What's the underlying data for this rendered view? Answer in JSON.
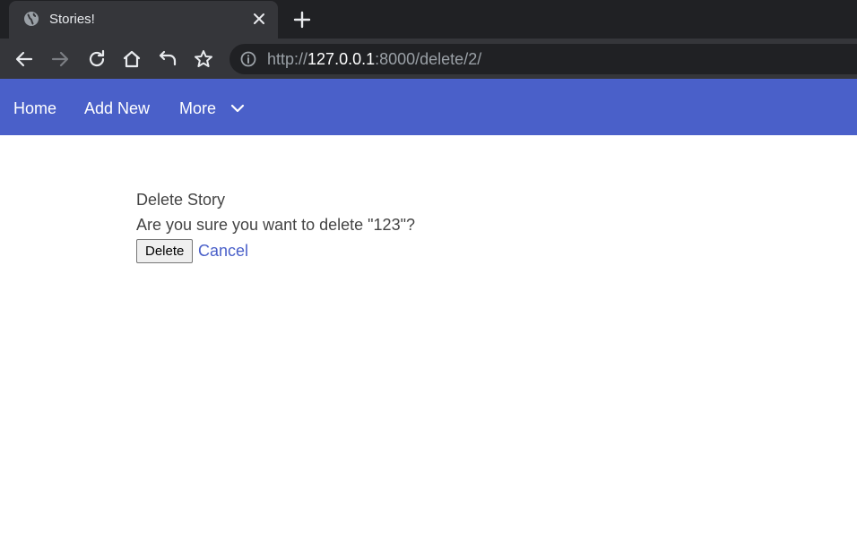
{
  "browser": {
    "tab_title": "Stories!",
    "url": {
      "scheme": "http://",
      "host": "127.0.0.1",
      "rest": ":8000/delete/2/"
    },
    "icons": {
      "favicon": "globe-icon",
      "close": "close-icon",
      "new_tab": "plus-icon",
      "back": "back-arrow-icon",
      "forward": "forward-arrow-icon",
      "reload": "reload-icon",
      "home": "home-icon",
      "undo": "undo-icon",
      "bookmark": "star-icon",
      "site_info": "info-icon"
    }
  },
  "navbar": {
    "links": [
      {
        "label": "Home"
      },
      {
        "label": "Add New"
      },
      {
        "label": "More"
      }
    ],
    "background": "#4a60c9"
  },
  "main": {
    "heading": "Delete Story",
    "question": "Are you sure you want to delete \"123\"?",
    "delete_button": "Delete",
    "cancel_link": "Cancel"
  }
}
